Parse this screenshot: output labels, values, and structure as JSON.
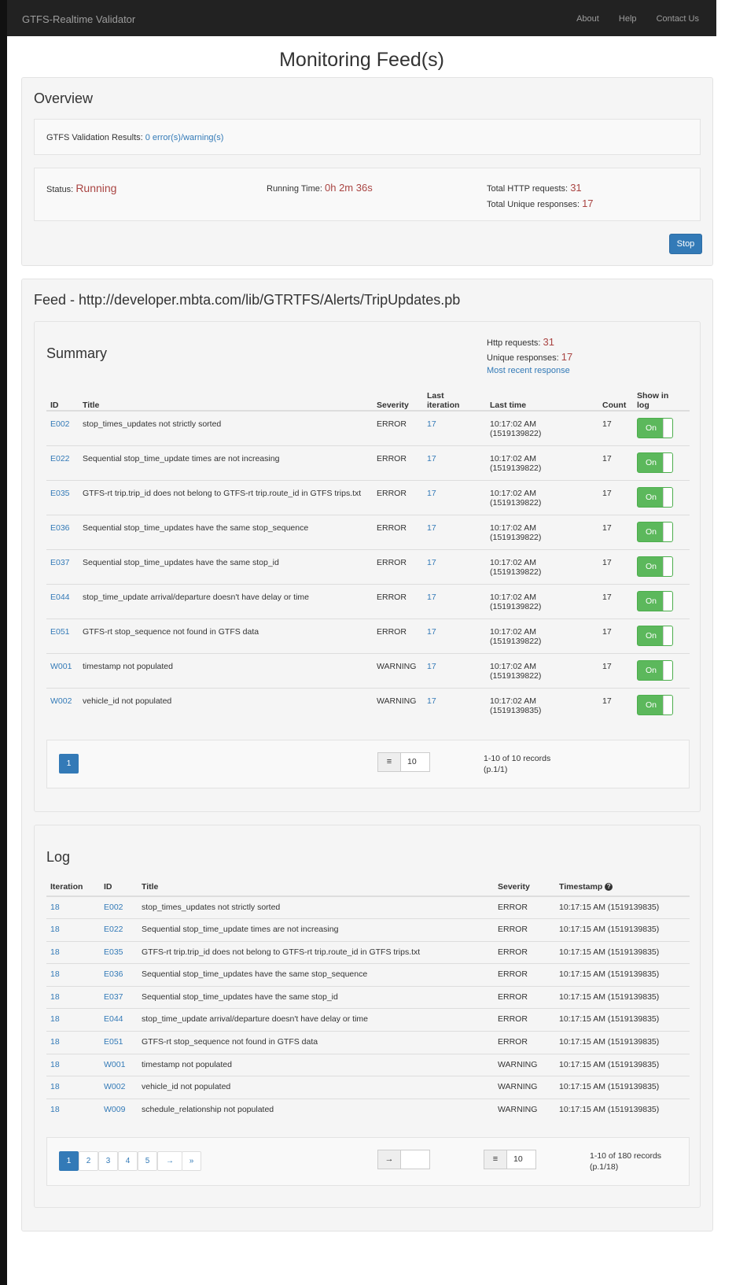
{
  "navbar": {
    "brand": "GTFS-Realtime Validator",
    "links": [
      "About",
      "Help",
      "Contact Us"
    ]
  },
  "page_title": "Monitoring Feed(s)",
  "overview": {
    "title": "Overview",
    "gtfs_results_label": "GTFS Validation Results:",
    "gtfs_results_link": "0 error(s)/warning(s)",
    "status_label": "Status:",
    "status_value": "Running",
    "running_time_label": "Running Time:",
    "running_time_value": "0h 2m 36s",
    "total_http_label": "Total HTTP requests:",
    "total_http_value": "31",
    "total_unique_label": "Total Unique responses:",
    "total_unique_value": "17",
    "stop_button": "Stop"
  },
  "feed": {
    "title": "Feed - http://developer.mbta.com/lib/GTRTFS/Alerts/TripUpdates.pb",
    "summary": {
      "title": "Summary",
      "http_label": "Http requests:",
      "http_value": "31",
      "unique_label": "Unique responses:",
      "unique_value": "17",
      "recent_link": "Most recent response",
      "headers": {
        "id": "ID",
        "title": "Title",
        "severity": "Severity",
        "last_iteration_1": "Last",
        "last_iteration_2": "iteration",
        "last_time": "Last time",
        "count": "Count",
        "show_1": "Show in",
        "show_2": "log"
      },
      "rows": [
        {
          "id": "E002",
          "title": "stop_times_updates not strictly sorted",
          "severity": "ERROR",
          "iteration": "17",
          "time": "10:17:02 AM",
          "epoch": "(1519139822)",
          "count": "17",
          "toggle": "On"
        },
        {
          "id": "E022",
          "title": "Sequential stop_time_update times are not increasing",
          "severity": "ERROR",
          "iteration": "17",
          "time": "10:17:02 AM",
          "epoch": "(1519139822)",
          "count": "17",
          "toggle": "On"
        },
        {
          "id": "E035",
          "title": "GTFS-rt trip.trip_id does not belong to GTFS-rt trip.route_id in GTFS trips.txt",
          "severity": "ERROR",
          "iteration": "17",
          "time": "10:17:02 AM",
          "epoch": "(1519139822)",
          "count": "17",
          "toggle": "On"
        },
        {
          "id": "E036",
          "title": "Sequential stop_time_updates have the same stop_sequence",
          "severity": "ERROR",
          "iteration": "17",
          "time": "10:17:02 AM",
          "epoch": "(1519139822)",
          "count": "17",
          "toggle": "On"
        },
        {
          "id": "E037",
          "title": "Sequential stop_time_updates have the same stop_id",
          "severity": "ERROR",
          "iteration": "17",
          "time": "10:17:02 AM",
          "epoch": "(1519139822)",
          "count": "17",
          "toggle": "On"
        },
        {
          "id": "E044",
          "title": "stop_time_update arrival/departure doesn't have delay or time",
          "severity": "ERROR",
          "iteration": "17",
          "time": "10:17:02 AM",
          "epoch": "(1519139822)",
          "count": "17",
          "toggle": "On"
        },
        {
          "id": "E051",
          "title": "GTFS-rt stop_sequence not found in GTFS data",
          "severity": "ERROR",
          "iteration": "17",
          "time": "10:17:02 AM",
          "epoch": "(1519139822)",
          "count": "17",
          "toggle": "On"
        },
        {
          "id": "W001",
          "title": "timestamp not populated",
          "severity": "WARNING",
          "iteration": "17",
          "time": "10:17:02 AM",
          "epoch": "(1519139822)",
          "count": "17",
          "toggle": "On"
        },
        {
          "id": "W002",
          "title": "vehicle_id not populated",
          "severity": "WARNING",
          "iteration": "17",
          "time": "10:17:02 AM",
          "epoch": "(1519139835)",
          "count": "17",
          "toggle": "On"
        }
      ],
      "pager": {
        "page": "1",
        "page_size": "10",
        "records": "1-10 of 10 records",
        "page_info": "(p.1/1)"
      }
    },
    "log": {
      "title": "Log",
      "headers": {
        "iteration": "Iteration",
        "id": "ID",
        "title": "Title",
        "severity": "Severity",
        "timestamp": "Timestamp"
      },
      "rows": [
        {
          "iteration": "18",
          "id": "E002",
          "title": "stop_times_updates not strictly sorted",
          "severity": "ERROR",
          "timestamp": "10:17:15 AM (1519139835)"
        },
        {
          "iteration": "18",
          "id": "E022",
          "title": "Sequential stop_time_update times are not increasing",
          "severity": "ERROR",
          "timestamp": "10:17:15 AM (1519139835)"
        },
        {
          "iteration": "18",
          "id": "E035",
          "title": "GTFS-rt trip.trip_id does not belong to GTFS-rt trip.route_id in GTFS trips.txt",
          "severity": "ERROR",
          "timestamp": "10:17:15 AM (1519139835)"
        },
        {
          "iteration": "18",
          "id": "E036",
          "title": "Sequential stop_time_updates have the same stop_sequence",
          "severity": "ERROR",
          "timestamp": "10:17:15 AM (1519139835)"
        },
        {
          "iteration": "18",
          "id": "E037",
          "title": "Sequential stop_time_updates have the same stop_id",
          "severity": "ERROR",
          "timestamp": "10:17:15 AM (1519139835)"
        },
        {
          "iteration": "18",
          "id": "E044",
          "title": "stop_time_update arrival/departure doesn't have delay or time",
          "severity": "ERROR",
          "timestamp": "10:17:15 AM (1519139835)"
        },
        {
          "iteration": "18",
          "id": "E051",
          "title": "GTFS-rt stop_sequence not found in GTFS data",
          "severity": "ERROR",
          "timestamp": "10:17:15 AM (1519139835)"
        },
        {
          "iteration": "18",
          "id": "W001",
          "title": "timestamp not populated",
          "severity": "WARNING",
          "timestamp": "10:17:15 AM (1519139835)"
        },
        {
          "iteration": "18",
          "id": "W002",
          "title": "vehicle_id not populated",
          "severity": "WARNING",
          "timestamp": "10:17:15 AM (1519139835)"
        },
        {
          "iteration": "18",
          "id": "W009",
          "title": "schedule_relationship not populated",
          "severity": "WARNING",
          "timestamp": "10:17:15 AM (1519139835)"
        }
      ],
      "pager": {
        "pages": [
          "1",
          "2",
          "3",
          "4",
          "5",
          "→",
          "»"
        ],
        "goto_icon": "→",
        "page_size": "10",
        "records": "1-10 of 180 records",
        "page_info": "(p.1/18)"
      }
    }
  },
  "icons": {
    "list": "list-icon",
    "goto": "arrow-right-icon",
    "help": "question-circle-icon"
  },
  "colors": {
    "navbar": "#222222",
    "link": "#337ab7",
    "status_red": "#a94442",
    "toggle_on": "#5cb85c"
  }
}
